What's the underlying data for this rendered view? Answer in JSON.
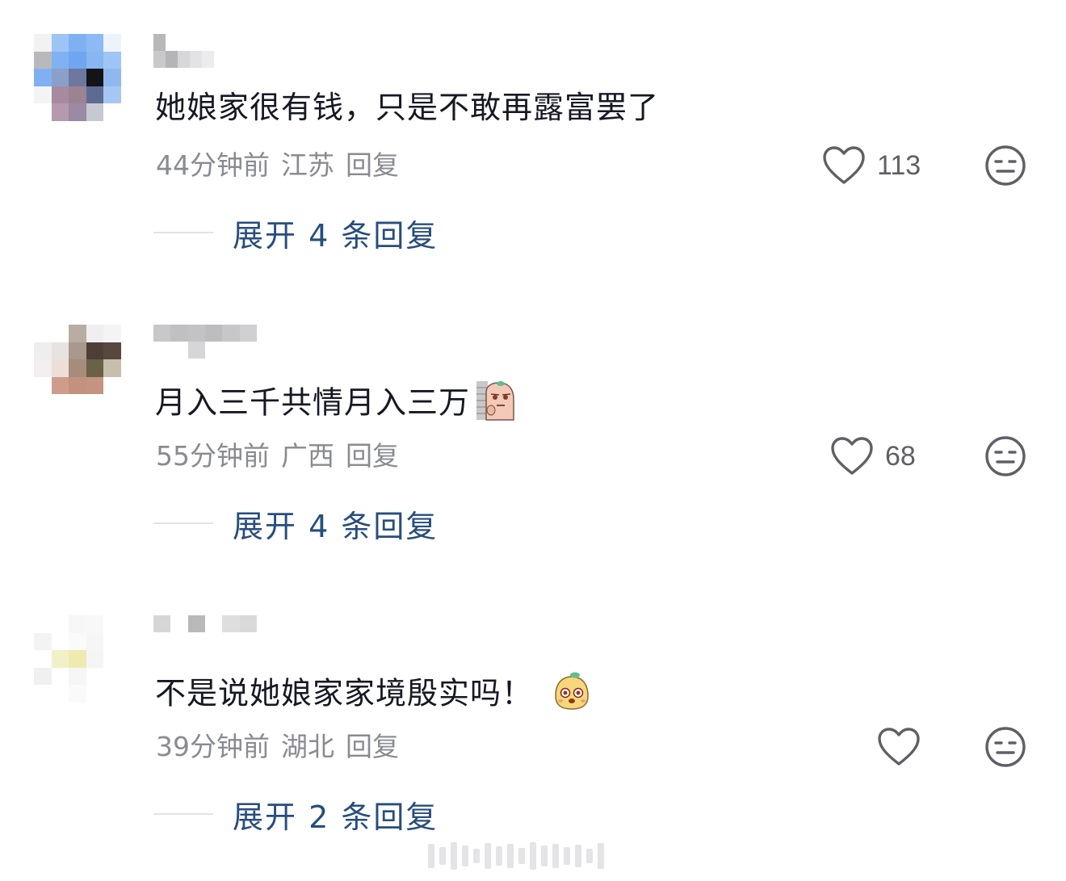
{
  "comments": [
    {
      "text": "她娘家很有钱，只是不敢再露富罢了",
      "time": "44分钟前",
      "location": "江苏",
      "reply_label": "回复",
      "likes": "113",
      "expand_label": "展开 4 条回复",
      "sticker": ""
    },
    {
      "text": "月入三千共情月入三万",
      "time": "55分钟前",
      "location": "广西",
      "reply_label": "回复",
      "likes": "68",
      "expand_label": "展开 4 条回复",
      "sticker": "wall-peek-sticker"
    },
    {
      "text": "不是说她娘家家境殷实吗！",
      "time": "39分钟前",
      "location": "湖北",
      "reply_label": "回复",
      "likes": "",
      "expand_label": "展开 2 条回复",
      "sticker": "cute-face-sticker"
    }
  ],
  "colors": {
    "text": "#161823",
    "meta": "#8a8b91",
    "expand": "#274e7c",
    "icon": "#5f6066"
  },
  "icons": {
    "like": "heart-icon",
    "dislike": "meh-face-icon"
  }
}
